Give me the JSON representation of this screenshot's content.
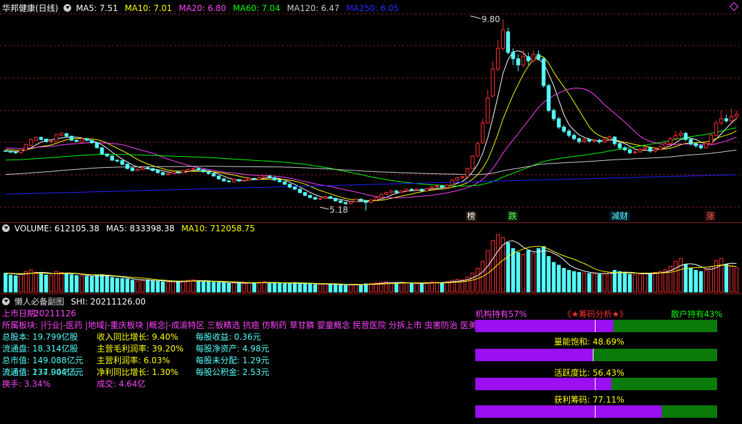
{
  "main_header": {
    "title": "华邦健康(日线)",
    "ma5": "MA5: 7.51",
    "ma10": "MA10: 7.01",
    "ma20": "MA20: 6.80",
    "ma60": "MA60: 7.04",
    "ma120": "MA120: 6.47",
    "ma250": "MA250: 6.05"
  },
  "volume_header": {
    "volume": "VOLUME: 612105.38",
    "ma5": "MA5: 833398.38",
    "ma10": "MA10: 712058.75"
  },
  "sub_header": {
    "name": "懒人必备副图",
    "value": "SHI: 20211126.00"
  },
  "markers": [
    "榜",
    "跌",
    "减财",
    "涨"
  ],
  "price_labels": {
    "high": "9.80",
    "low": "5.18"
  },
  "info": {
    "list_date": "上市日期:",
    "list_date_value": "20211126",
    "sectors": "所属板块: |行业|-医药 |地域|-重庆板块 |概念|-成渝特区 三板精选 抗癌 仿制药 草甘膦 婴童概念 民营医院 分拆上市 虫害防治 医美概念",
    "col1": [
      "总股本: 19.799亿股",
      "流通盘: 18.314亿股",
      "总市值: 149.088亿元",
      "流通值: 137.904亿元",
      "换手: 3.34%"
    ],
    "col1_overlap": "流通值: 274.04亿元",
    "col2": [
      "收入同比增长: 9.40%",
      "主营毛利润率: 39.20%",
      "主营利润率: 6.03%",
      "净利同比增长: 1.30%",
      "成交: 4.64亿"
    ],
    "col3": [
      "每股收益: 0.36元",
      "每股净资产: 4.98元",
      "每股未分配: 1.29元",
      "每股公积金: 2.53元"
    ]
  },
  "chips": {
    "inst": "机构持有57%",
    "title": "《★筹码分析★》",
    "retail": "散户持有43%",
    "bars": [
      {
        "label": "",
        "fill": 0.57
      },
      {
        "label": "量能饱和: 48.69%",
        "fill": 0.487
      },
      {
        "label": "活跃度比: 56.43%",
        "fill": 0.564
      },
      {
        "label": "获利筹码: 77.11%",
        "fill": 0.771
      }
    ]
  },
  "colors": {
    "up": "#ff3232",
    "down": "#54ffff",
    "ma5": "#ffffff",
    "ma10": "#ffff00",
    "ma20": "#ff44ff",
    "ma60": "#00ff00",
    "ma120": "#cccccc",
    "ma250": "#2222ff",
    "grid": "#8b1a1a",
    "purple": "#9a10f0",
    "green": "#0a7a0a"
  },
  "chart_data": {
    "type": "candlestick",
    "ylim": [
      5.0,
      10.0
    ],
    "ohlc": [
      [
        6.63,
        6.62,
        6.61,
        6.62
      ],
      [
        6.61,
        6.6,
        6.58,
        6.62
      ],
      [
        6.6,
        6.58,
        6.55,
        6.61
      ],
      [
        6.58,
        6.65,
        6.56,
        6.66
      ],
      [
        6.64,
        6.78,
        6.63,
        6.8
      ],
      [
        6.76,
        6.9,
        6.75,
        6.92
      ],
      [
        6.88,
        6.95,
        6.87,
        6.97
      ],
      [
        6.95,
        6.9,
        6.88,
        6.97
      ],
      [
        6.91,
        6.85,
        6.83,
        6.92
      ],
      [
        6.84,
        6.86,
        6.82,
        6.88
      ],
      [
        6.86,
        7.02,
        6.85,
        7.04
      ],
      [
        7.0,
        7.05,
        6.98,
        7.07
      ],
      [
        7.04,
        6.98,
        6.96,
        7.06
      ],
      [
        6.98,
        6.88,
        6.87,
        6.99
      ],
      [
        6.88,
        6.85,
        6.84,
        6.9
      ],
      [
        6.84,
        6.92,
        6.83,
        6.94
      ],
      [
        6.92,
        6.88,
        6.86,
        6.94
      ],
      [
        6.88,
        6.82,
        6.8,
        6.89
      ],
      [
        6.82,
        6.7,
        6.69,
        6.84
      ],
      [
        6.7,
        6.55,
        6.54,
        6.72
      ],
      [
        6.55,
        6.5,
        6.48,
        6.57
      ],
      [
        6.5,
        6.4,
        6.39,
        6.52
      ],
      [
        6.4,
        6.38,
        6.35,
        6.42
      ],
      [
        6.39,
        6.3,
        6.28,
        6.4
      ],
      [
        6.31,
        6.2,
        6.18,
        6.32
      ],
      [
        6.21,
        6.15,
        6.13,
        6.22
      ],
      [
        6.15,
        6.18,
        6.14,
        6.2
      ],
      [
        6.18,
        6.22,
        6.16,
        6.24
      ],
      [
        6.22,
        6.2,
        6.18,
        6.24
      ],
      [
        6.2,
        6.15,
        6.13,
        6.21
      ],
      [
        6.16,
        6.1,
        6.08,
        6.17
      ],
      [
        6.1,
        6.05,
        6.03,
        6.12
      ],
      [
        6.05,
        6.08,
        6.03,
        6.1
      ],
      [
        6.08,
        6.12,
        6.06,
        6.15
      ],
      [
        6.12,
        6.1,
        6.08,
        6.14
      ],
      [
        6.1,
        6.15,
        6.09,
        6.17
      ],
      [
        6.14,
        6.18,
        6.13,
        6.2
      ],
      [
        6.18,
        6.2,
        6.16,
        6.22
      ],
      [
        6.2,
        6.16,
        6.14,
        6.22
      ],
      [
        6.17,
        6.12,
        6.1,
        6.18
      ],
      [
        6.12,
        6.08,
        6.05,
        6.13
      ],
      [
        6.08,
        6.02,
        6.0,
        6.1
      ],
      [
        6.02,
        5.95,
        5.93,
        6.03
      ],
      [
        5.95,
        5.9,
        5.88,
        5.97
      ],
      [
        5.9,
        5.88,
        5.86,
        5.92
      ],
      [
        5.88,
        5.94,
        5.86,
        5.96
      ],
      [
        5.93,
        5.9,
        5.88,
        5.95
      ],
      [
        5.9,
        5.92,
        5.88,
        5.94
      ],
      [
        5.92,
        5.96,
        5.9,
        5.98
      ],
      [
        5.96,
        5.94,
        5.92,
        5.98
      ],
      [
        5.94,
        5.98,
        5.92,
        6.0
      ],
      [
        5.98,
        6.02,
        5.96,
        6.04
      ],
      [
        6.02,
        5.98,
        5.96,
        6.04
      ],
      [
        5.98,
        5.92,
        5.9,
        6.0
      ],
      [
        5.92,
        5.88,
        5.86,
        5.94
      ],
      [
        5.88,
        5.82,
        5.8,
        5.9
      ],
      [
        5.82,
        5.75,
        5.72,
        5.84
      ],
      [
        5.75,
        5.7,
        5.68,
        5.77
      ],
      [
        5.7,
        5.62,
        5.6,
        5.72
      ],
      [
        5.62,
        5.55,
        5.53,
        5.64
      ],
      [
        5.55,
        5.5,
        5.48,
        5.57
      ],
      [
        5.5,
        5.46,
        5.44,
        5.52
      ],
      [
        5.46,
        5.48,
        5.43,
        5.5
      ],
      [
        5.48,
        5.52,
        5.46,
        5.54
      ],
      [
        5.52,
        5.48,
        5.46,
        5.54
      ],
      [
        5.48,
        5.42,
        5.4,
        5.5
      ],
      [
        5.42,
        5.38,
        5.36,
        5.44
      ],
      [
        5.38,
        5.35,
        5.33,
        5.4
      ],
      [
        5.35,
        5.4,
        5.33,
        5.42
      ],
      [
        5.4,
        5.46,
        5.38,
        5.48
      ],
      [
        5.46,
        5.42,
        5.4,
        5.48
      ],
      [
        5.42,
        5.38,
        5.18,
        5.44
      ],
      [
        5.38,
        5.44,
        5.36,
        5.46
      ],
      [
        5.44,
        5.5,
        5.42,
        5.52
      ],
      [
        5.5,
        5.58,
        5.48,
        5.6
      ],
      [
        5.58,
        5.62,
        5.55,
        5.64
      ],
      [
        5.62,
        5.66,
        5.6,
        5.68
      ],
      [
        5.66,
        5.62,
        5.6,
        5.68
      ],
      [
        5.62,
        5.66,
        5.6,
        5.68
      ],
      [
        5.66,
        5.7,
        5.64,
        5.72
      ],
      [
        5.7,
        5.68,
        5.66,
        5.72
      ],
      [
        5.68,
        5.7,
        5.66,
        5.72
      ],
      [
        5.7,
        5.66,
        5.64,
        5.72
      ],
      [
        5.66,
        5.72,
        5.64,
        5.74
      ],
      [
        5.72,
        5.76,
        5.7,
        5.78
      ],
      [
        5.76,
        5.78,
        5.74,
        5.8
      ],
      [
        5.78,
        5.74,
        5.72,
        5.8
      ],
      [
        5.74,
        5.8,
        5.72,
        5.82
      ],
      [
        5.8,
        5.92,
        5.79,
        5.94
      ],
      [
        5.92,
        5.98,
        5.9,
        6.0
      ],
      [
        5.98,
        6.0,
        5.96,
        6.02
      ],
      [
        6.0,
        6.2,
        5.99,
        6.22
      ],
      [
        6.2,
        6.5,
        6.19,
        6.52
      ],
      [
        6.5,
        6.8,
        6.49,
        6.84
      ],
      [
        6.82,
        7.3,
        6.8,
        7.4
      ],
      [
        7.3,
        7.9,
        7.28,
        8.1
      ],
      [
        7.95,
        8.6,
        7.92,
        8.8
      ],
      [
        8.6,
        9.1,
        8.55,
        9.3
      ],
      [
        9.1,
        9.55,
        9.05,
        9.8
      ],
      [
        9.5,
        9.0,
        8.95,
        9.6
      ],
      [
        9.0,
        8.85,
        8.7,
        9.1
      ],
      [
        8.85,
        8.7,
        8.55,
        8.95
      ],
      [
        8.7,
        8.9,
        8.65,
        9.05
      ],
      [
        8.9,
        8.8,
        8.7,
        9.0
      ],
      [
        8.8,
        8.95,
        8.75,
        9.05
      ],
      [
        8.95,
        8.85,
        8.8,
        9.05
      ],
      [
        8.85,
        8.2,
        8.15,
        8.9
      ],
      [
        8.2,
        7.6,
        7.55,
        8.25
      ],
      [
        7.6,
        7.4,
        7.35,
        7.65
      ],
      [
        7.4,
        7.2,
        7.15,
        7.45
      ],
      [
        7.2,
        7.1,
        7.05,
        7.25
      ],
      [
        7.1,
        7.0,
        6.95,
        7.15
      ],
      [
        7.0,
        6.92,
        6.88,
        7.05
      ],
      [
        6.92,
        6.85,
        6.8,
        6.95
      ],
      [
        6.85,
        6.9,
        6.82,
        6.95
      ],
      [
        6.9,
        6.86,
        6.82,
        6.94
      ],
      [
        6.86,
        6.88,
        6.84,
        6.92
      ],
      [
        6.88,
        6.84,
        6.8,
        6.92
      ],
      [
        6.84,
        6.9,
        6.82,
        6.94
      ],
      [
        6.9,
        6.96,
        6.88,
        7.0
      ],
      [
        6.96,
        6.8,
        6.75,
        6.98
      ],
      [
        6.8,
        6.7,
        6.65,
        6.84
      ],
      [
        6.7,
        6.65,
        6.62,
        6.74
      ],
      [
        6.65,
        6.58,
        6.55,
        6.68
      ],
      [
        6.58,
        6.6,
        6.55,
        6.64
      ],
      [
        6.6,
        6.66,
        6.58,
        6.7
      ],
      [
        6.66,
        6.7,
        6.64,
        6.74
      ],
      [
        6.7,
        6.62,
        6.58,
        6.74
      ],
      [
        6.62,
        6.66,
        6.58,
        6.7
      ],
      [
        6.66,
        6.72,
        6.64,
        6.76
      ],
      [
        6.72,
        6.8,
        6.7,
        6.84
      ],
      [
        6.8,
        6.92,
        6.78,
        6.96
      ],
      [
        6.92,
        7.0,
        6.9,
        7.1
      ],
      [
        7.0,
        7.05,
        6.95,
        7.12
      ],
      [
        7.05,
        6.9,
        6.86,
        7.08
      ],
      [
        6.9,
        6.8,
        6.75,
        6.94
      ],
      [
        6.8,
        6.75,
        6.7,
        6.84
      ],
      [
        6.75,
        6.7,
        6.66,
        6.78
      ],
      [
        6.7,
        6.8,
        6.68,
        6.84
      ],
      [
        6.8,
        7.0,
        6.78,
        7.05
      ],
      [
        7.0,
        7.3,
        6.98,
        7.35
      ],
      [
        7.3,
        7.4,
        7.25,
        7.6
      ],
      [
        7.4,
        7.35,
        7.3,
        7.5
      ],
      [
        7.35,
        7.45,
        7.3,
        7.65
      ],
      [
        7.45,
        7.51,
        7.4,
        7.6
      ]
    ],
    "volume_ylim": [
      0,
      1500000
    ],
    "volume": [
      480000,
      430000,
      410000,
      450000,
      520000,
      560000,
      500000,
      460000,
      430000,
      420000,
      520000,
      500000,
      470000,
      440000,
      420000,
      410000,
      400000,
      390000,
      420000,
      440000,
      400000,
      370000,
      350000,
      340000,
      330000,
      300000,
      280000,
      300000,
      310000,
      290000,
      270000,
      260000,
      250000,
      260000,
      270000,
      280000,
      300000,
      310000,
      290000,
      270000,
      260000,
      250000,
      240000,
      230000,
      220000,
      240000,
      230000,
      220000,
      230000,
      240000,
      250000,
      260000,
      240000,
      230000,
      220000,
      210000,
      230000,
      240000,
      220000,
      210000,
      200000,
      190000,
      200000,
      210000,
      200000,
      190000,
      180000,
      170000,
      180000,
      200000,
      190000,
      210000,
      220000,
      230000,
      250000,
      260000,
      240000,
      230000,
      240000,
      230000,
      220000,
      210000,
      220000,
      240000,
      260000,
      250000,
      240000,
      260000,
      300000,
      320000,
      310000,
      380000,
      480000,
      600000,
      780000,
      1050000,
      1300000,
      1450000,
      1380000,
      1250000,
      1100000,
      1000000,
      950000,
      1050000,
      980000,
      1100000,
      1150000,
      900000,
      750000,
      680000,
      600000,
      550000,
      520000,
      500000,
      480000,
      470000,
      460000,
      450000,
      470000,
      500000,
      550000,
      520000,
      480000,
      450000,
      440000,
      460000,
      480000,
      470000,
      500000,
      520000,
      560000,
      650000,
      780000,
      850000,
      700000,
      600000,
      550000,
      520000,
      560000,
      650000,
      800000,
      850000,
      700000,
      650000,
      612105
    ]
  }
}
